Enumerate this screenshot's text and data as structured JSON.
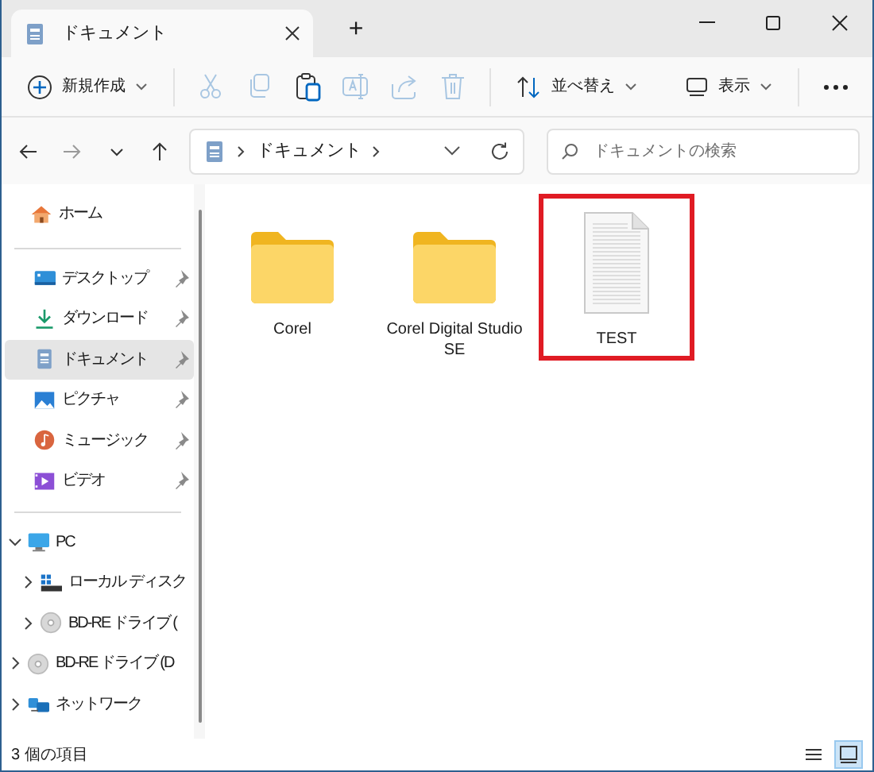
{
  "window": {
    "tab_title": "ドキュメント",
    "new_tab": "+"
  },
  "toolbar": {
    "new_label": "新規作成",
    "actions": [
      {
        "kind": "cut",
        "disabled": true
      },
      {
        "kind": "copy",
        "disabled": true
      },
      {
        "kind": "paste",
        "disabled": false
      },
      {
        "kind": "rename",
        "disabled": true
      },
      {
        "kind": "share",
        "disabled": true
      },
      {
        "kind": "delete",
        "disabled": true
      }
    ],
    "sort_label": "並べ替え",
    "view_label": "表示"
  },
  "navigation": {
    "back_disabled": false,
    "forward_disabled": true
  },
  "address": {
    "path": [
      "ドキュメント"
    ]
  },
  "search": {
    "placeholder": "ドキュメントの検索"
  },
  "sidebar": {
    "home": {
      "label": "ホーム",
      "kind": "home",
      "selected": false
    },
    "quick_access": [
      {
        "label": "デスクトップ",
        "kind": "desktop",
        "pinned": true,
        "selected": false
      },
      {
        "label": "ダウンロード",
        "kind": "download",
        "pinned": true,
        "selected": false
      },
      {
        "label": "ドキュメント",
        "kind": "documents",
        "pinned": true,
        "selected": true
      },
      {
        "label": "ピクチャ",
        "kind": "pictures",
        "pinned": true,
        "selected": false
      },
      {
        "label": "ミュージック",
        "kind": "music",
        "pinned": true,
        "selected": false
      },
      {
        "label": "ビデオ",
        "kind": "videos",
        "pinned": true,
        "selected": false
      }
    ],
    "tree": [
      {
        "label": "PC",
        "kind": "pc",
        "expanded": true,
        "children": [
          {
            "label": "ローカル ディスク",
            "kind": "disk",
            "expanded": false
          },
          {
            "label": "BD-RE ドライブ (",
            "kind": "disc",
            "expanded": false
          }
        ]
      },
      {
        "label": "BD-RE ドライブ (D",
        "kind": "disc",
        "expanded": false
      },
      {
        "label": "ネットワーク",
        "kind": "network",
        "expanded": false
      }
    ]
  },
  "files": [
    {
      "name": "Corel",
      "kind": "folder",
      "highlighted": false
    },
    {
      "name": "Corel Digital Studio SE",
      "kind": "folder",
      "highlighted": false
    },
    {
      "name": "TEST",
      "kind": "document",
      "highlighted": true
    }
  ],
  "status_bar": {
    "count": "3 個の項目",
    "views": [
      {
        "kind": "details",
        "selected": false
      },
      {
        "kind": "large_icons",
        "selected": true
      }
    ]
  }
}
